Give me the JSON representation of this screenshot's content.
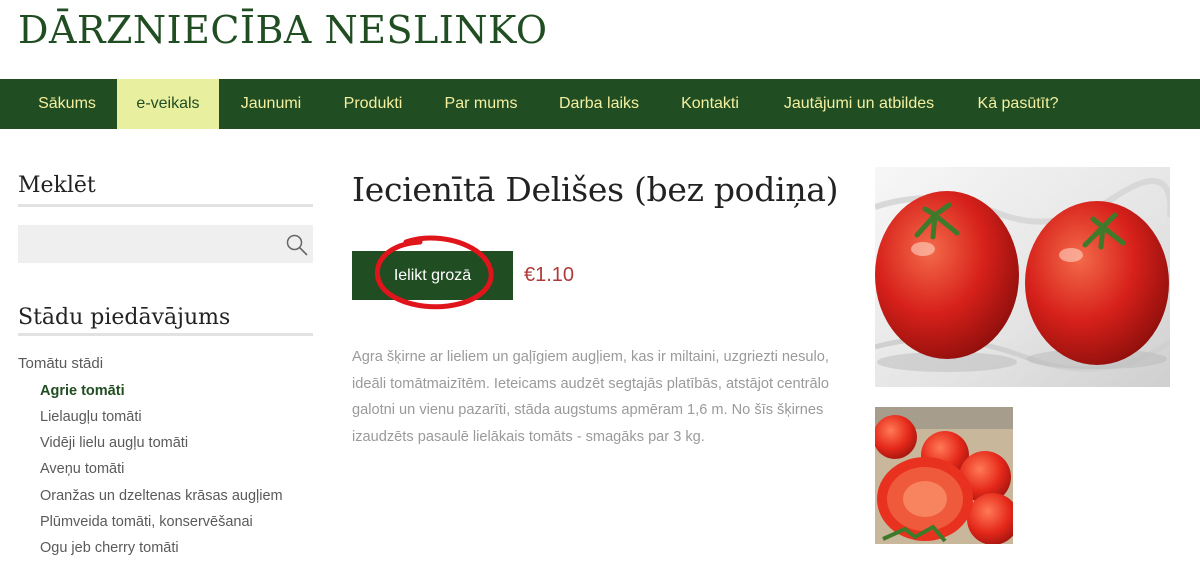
{
  "site": {
    "title": "DĀRZNIECĪBA NESLINKO"
  },
  "nav": {
    "items": [
      {
        "label": "Sākums"
      },
      {
        "label": "e-veikals"
      },
      {
        "label": "Jaunumi"
      },
      {
        "label": "Produkti"
      },
      {
        "label": "Par mums"
      },
      {
        "label": "Darba laiks"
      },
      {
        "label": "Kontakti"
      },
      {
        "label": "Jautājumi un atbildes"
      },
      {
        "label": "Kā pasūtīt?"
      }
    ],
    "active": "e-veikals"
  },
  "sidebar": {
    "search": {
      "title": "Meklēt",
      "value": "",
      "icon": "search-icon"
    },
    "categories": {
      "title": "Stādu piedāvājums",
      "parent": "Tomātu stādi",
      "items": [
        {
          "label": "Agrie tomāti"
        },
        {
          "label": "Lielaugļu tomāti"
        },
        {
          "label": "Vidēji lielu augļu tomāti"
        },
        {
          "label": "Aveņu tomāti"
        },
        {
          "label": "Oranžas un dzeltenas krāsas augļiem"
        },
        {
          "label": "Plūmveida tomāti, konservēšanai"
        },
        {
          "label": "Ogu jeb cherry tomāti"
        }
      ],
      "current": "Agrie tomāti"
    }
  },
  "product": {
    "title": "Iecienītā Delišes (bez podiņa)",
    "add_to_cart_label": "Ielikt grozā",
    "price": "€1.10",
    "description": "Agra šķirne ar lieliem un gaļīgiem augļiem, kas ir miltaini, uzgriezti nesulo, ideāli tomātmaizītēm. Ieteicams audzēt segtajās platībās, atstājot centrālo galotni un vienu pazarīti, stāda augstums apmēram 1,6 m. No šīs šķirnes izaudzēts pasaulē lielākais tomāts - smagāks par 3 kg."
  },
  "colors": {
    "brand_green": "#214d22",
    "nav_text": "#f3f0a0",
    "nav_active_bg": "#e8ef9f",
    "price": "#b03a3a",
    "annotation_circle": "#e0141b"
  }
}
